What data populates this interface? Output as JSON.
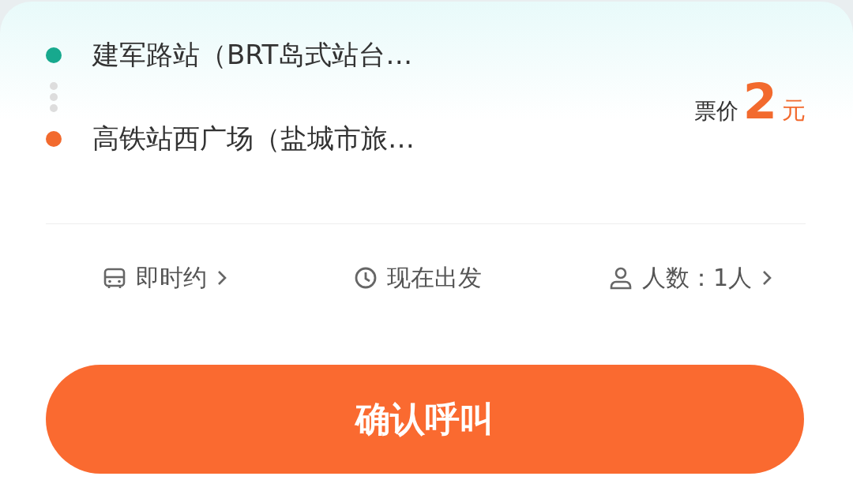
{
  "route": {
    "stops": [
      {
        "name": "建军路站（BRT岛式站台…",
        "color": "#17a98e"
      },
      {
        "name": "高铁站西广场（盐城市旅…",
        "color": "#f26a2e"
      }
    ]
  },
  "fare": {
    "label": "票价",
    "amount": "2",
    "unit": "元"
  },
  "options": [
    {
      "kind": "bus",
      "label": "即时约",
      "chevron": true
    },
    {
      "kind": "clock",
      "label": "现在出发",
      "chevron": false
    },
    {
      "kind": "person",
      "label": "人数：1人",
      "chevron": true
    }
  ],
  "confirm_button": {
    "label": "确认呼叫"
  }
}
